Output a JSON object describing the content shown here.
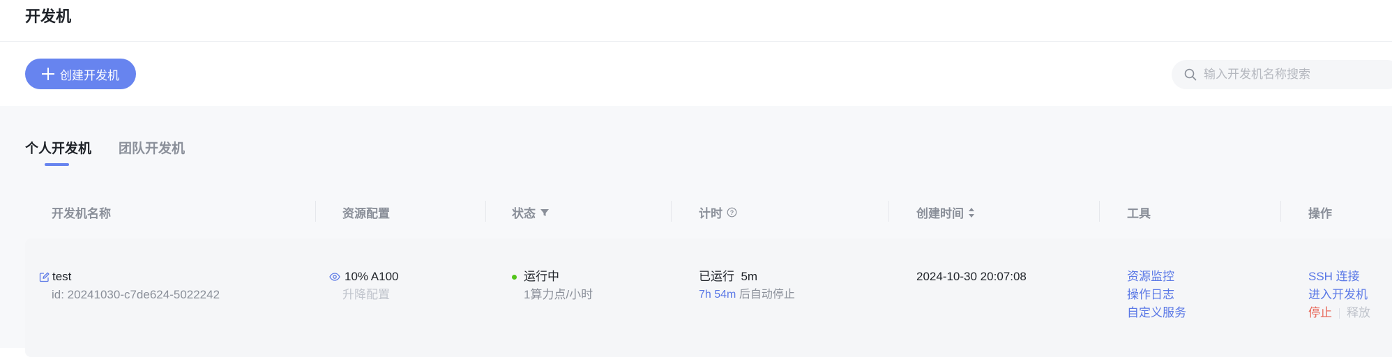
{
  "header": {
    "title": "开发机"
  },
  "toolbar": {
    "create_label": "创建开发机",
    "search_placeholder": "输入开发机名称搜索"
  },
  "tabs": [
    {
      "label": "个人开发机",
      "active": true
    },
    {
      "label": "团队开发机",
      "active": false
    }
  ],
  "table": {
    "columns": {
      "name": "开发机名称",
      "resource": "资源配置",
      "status": "状态",
      "timer": "计时",
      "created": "创建时间",
      "tools": "工具",
      "actions": "操作"
    },
    "rows": [
      {
        "name": "test",
        "id": "id: 20241030-c7de624-5022242",
        "resource": "10% A100",
        "resource_action": "升降配置",
        "status": "运行中",
        "status_color": "#52c41a",
        "price": "1算力点/小时",
        "running_label": "已运行",
        "running_value": "5m",
        "remaining": "7h 54m",
        "remaining_suffix": "后自动停止",
        "created": "2024-10-30 20:07:08",
        "tools": [
          "资源监控",
          "操作日志",
          "自定义服务"
        ],
        "actions": {
          "ssh": "SSH 连接",
          "enter": "进入开发机",
          "stop": "停止",
          "release": "释放"
        }
      }
    ]
  },
  "colors": {
    "accent": "#6784ef",
    "link": "#5a78e6",
    "danger": "#e8685a",
    "success": "#52c41a"
  }
}
